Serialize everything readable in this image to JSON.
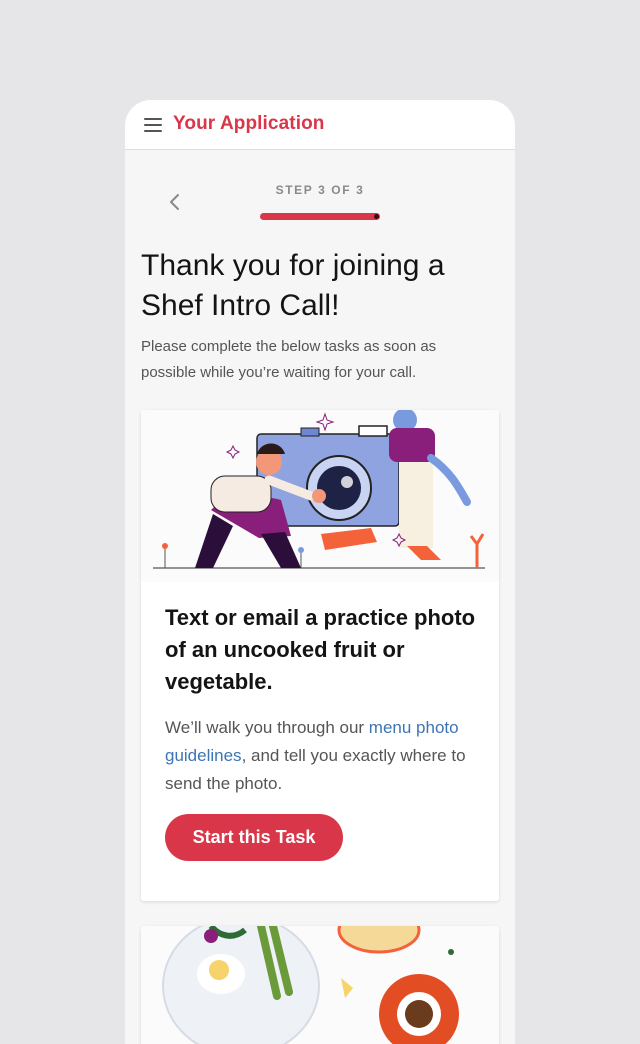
{
  "app_bar": {
    "title": "Your Application",
    "menu_icon": "hamburger-menu-icon"
  },
  "stepper": {
    "back_icon": "chevron-left-icon",
    "label": "STEP 3 OF 3",
    "progress": 1.0
  },
  "main": {
    "heading": "Thank you for joining a Shef Intro Call!",
    "subheading": "Please complete the below tasks as soon as possible while you’re waiting for your call."
  },
  "task_card": {
    "illustration": "camera-photographer-illustration",
    "title": "Text or email a practice photo of an uncooked fruit or vegetable.",
    "body_before": "We’ll walk you through our ",
    "link_text": "menu photo guidelines",
    "body_after": ", and tell you exactly where to send the photo.",
    "button_label": "Start this Task"
  },
  "next_card": {
    "illustration": "breakfast-food-illustration"
  },
  "colors": {
    "brand": "#d9364a",
    "link": "#3d75b3",
    "background": "#e6e6e8",
    "surface": "#f6f6f6"
  }
}
